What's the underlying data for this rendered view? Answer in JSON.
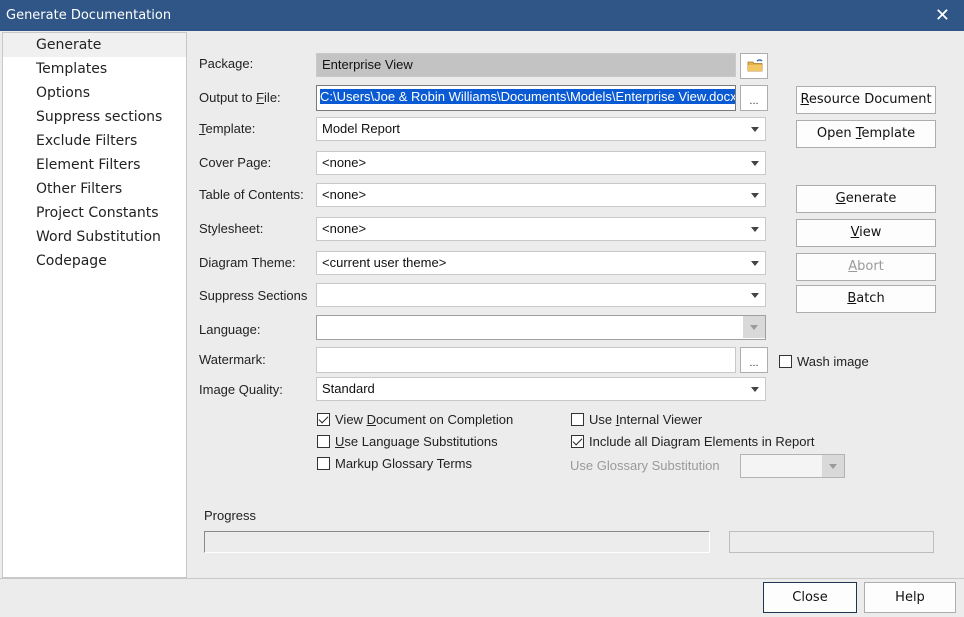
{
  "window": {
    "title": "Generate Documentation",
    "close_icon": "close-icon"
  },
  "sidebar": {
    "items": [
      {
        "label": "Generate",
        "selected": true
      },
      {
        "label": "Templates"
      },
      {
        "label": "Options"
      },
      {
        "label": "Suppress sections"
      },
      {
        "label": "Exclude Filters"
      },
      {
        "label": "Element Filters"
      },
      {
        "label": "Other Filters"
      },
      {
        "label": "Project Constants"
      },
      {
        "label": "Word Substitution"
      },
      {
        "label": "Codepage"
      }
    ]
  },
  "form": {
    "package": {
      "label": "Package:",
      "value": "Enterprise View",
      "browse_icon": "folder-icon"
    },
    "output_file": {
      "label_pre": "Output to ",
      "label_u": "F",
      "label_post": "ile:",
      "value": "C:\\Users\\Joe & Robin Williams\\Documents\\Models\\Enterprise View.docx",
      "browse_label": "..."
    },
    "template": {
      "label_u": "T",
      "label_post": "emplate:",
      "value": "Model Report"
    },
    "cover_page": {
      "label": "Cover Page:",
      "value": "<none>"
    },
    "toc": {
      "label": "Table of Contents:",
      "value": "<none>"
    },
    "stylesheet": {
      "label": "Stylesheet:",
      "value": "<none>"
    },
    "diagram_theme": {
      "label": "Diagram Theme:",
      "value": "<current user theme>"
    },
    "suppress_sections": {
      "label": "Suppress Sections",
      "value": ""
    },
    "language": {
      "label": "Language:",
      "value": ""
    },
    "watermark": {
      "label": "Watermark:",
      "value": "",
      "browse_label": "...",
      "wash_image": {
        "label": "Wash image",
        "checked": false
      }
    },
    "image_quality": {
      "label": "Image Quality:",
      "value": "Standard"
    }
  },
  "options": {
    "view_doc": {
      "pre": "View ",
      "u": "D",
      "post": "ocument on Completion",
      "checked": true
    },
    "use_lang": {
      "pre": "",
      "u": "U",
      "post": "se Language Substitutions",
      "checked": false
    },
    "markup_glossary": {
      "label": "Markup Glossary Terms",
      "checked": false
    },
    "internal_viewer": {
      "pre": "Use ",
      "u": "I",
      "post": "nternal Viewer",
      "checked": false
    },
    "include_all": {
      "label": "Include all Diagram Elements in Report",
      "checked": true
    },
    "glossary_subst": {
      "label": "Use Glossary Substitution",
      "value": ""
    }
  },
  "buttons": {
    "resource_document": {
      "u": "R",
      "post": "esource Document"
    },
    "open_template": {
      "pre": "Open ",
      "u": "T",
      "post": "emplate"
    },
    "generate": {
      "u": "G",
      "post": "enerate"
    },
    "view": {
      "u": "V",
      "post": "iew"
    },
    "abort": {
      "u": "A",
      "post": "bort"
    },
    "batch": {
      "u": "B",
      "post": "atch"
    },
    "close": "Close",
    "help": "Help"
  },
  "progress": {
    "label": "Progress",
    "value": 0,
    "status": ""
  }
}
